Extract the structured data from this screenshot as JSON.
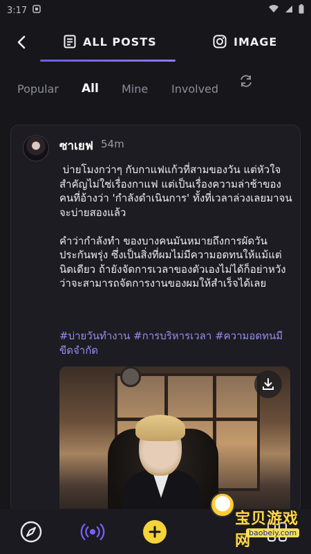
{
  "status_bar": {
    "time": "3:17"
  },
  "top_nav": {
    "tabs": [
      {
        "label": "ALL POSTS",
        "icon": "document-list-icon",
        "active": true
      },
      {
        "label": "IMAGE",
        "icon": "instagram-icon",
        "active": false
      }
    ],
    "accent_color": "#6b5cf0"
  },
  "filters": [
    {
      "label": "Popular",
      "active": false
    },
    {
      "label": "All",
      "active": true
    },
    {
      "label": "Mine",
      "active": false
    },
    {
      "label": "Involved",
      "active": false
    }
  ],
  "post": {
    "username": "ซาเยฟ",
    "time_ago": "54m",
    "body": " บ่ายโมงกว่าๆ กับกาแฟแก้วที่สามของวัน แต่หัวใจสำคัญไม่ใช่เรื่องกาแฟ แต่เป็นเรื่องความล่าช้าของคนที่อ้างว่า 'กำลังดำเนินการ' ทั้งที่เวลาล่วงเลยมาจนจะบ่ายสองแล้ว\n\nคำว่ากำลังทำ ของบางคนมันหมายถึงการผัดวันประกันพรุ่ง ซึ่งเป็นสิ่งที่ผมไม่มีความอดทนให้แม้แต่นิดเดียว ถ้ายังจัดการเวลาของตัวเองไม่ได้ก็อย่าหวังว่าจะสามารถจัดการงานของผมให้สำเร็จได้เลย",
    "hashtags": "#บ่ายวันทำงาน #การบริหารเวลา #ความอดทนมีขีดจำกัด",
    "hashtag_color": "#9a8cf0"
  },
  "bottom_nav": {
    "items": [
      "compass-icon",
      "broadcast-icon",
      "add-icon",
      "grid-icon"
    ],
    "add_color": "#f5d33a"
  },
  "watermark": {
    "text": "宝贝游戏网",
    "url": "baobeiy.com"
  }
}
